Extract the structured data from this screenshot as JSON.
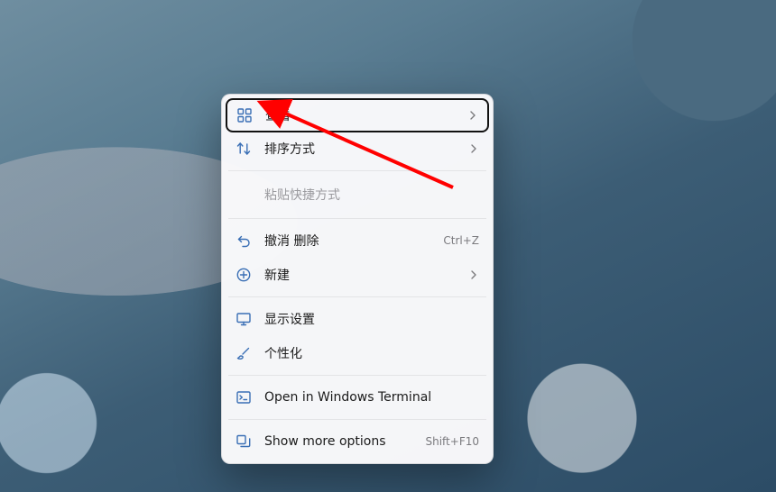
{
  "menu": {
    "view": {
      "label": "查看"
    },
    "sort": {
      "label": "排序方式"
    },
    "paste": {
      "label": "粘贴快捷方式"
    },
    "undo": {
      "label": "撤消 删除",
      "shortcut": "Ctrl+Z"
    },
    "new": {
      "label": "新建"
    },
    "display": {
      "label": "显示设置"
    },
    "personalize": {
      "label": "个性化"
    },
    "terminal": {
      "label": "Open in Windows Terminal"
    },
    "more": {
      "label": "Show more options",
      "shortcut": "Shift+F10"
    }
  },
  "colors": {
    "icon_accent": "#3a6fb5",
    "menu_bg": "#f9f9fb",
    "arrow": "#ff0000"
  }
}
